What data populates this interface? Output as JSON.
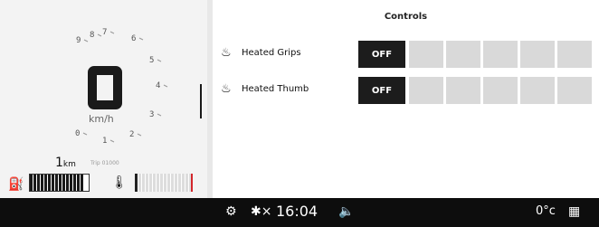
{
  "dashboard": {
    "gauge_ticks": [
      "9",
      "8",
      "7",
      "6",
      "5",
      "4",
      "3",
      "2",
      "1",
      "0"
    ],
    "speed_unit": "km/h",
    "odometer_value": "1",
    "odometer_unit": "km",
    "odometer_small": "Trip 01000",
    "fuel_level": 0.9,
    "temp_level": 0.05
  },
  "controls": {
    "title": "Controls",
    "rows": [
      {
        "label": "Heated Grips",
        "state_label": "OFF",
        "icon": "heated-grips-icon",
        "level": 0
      },
      {
        "label": "Heated Thumb",
        "state_label": "OFF",
        "icon": "heated-thumb-icon",
        "level": 0
      }
    ]
  },
  "statusbar": {
    "clock": "16:04",
    "temperature": "0°c",
    "icons": [
      "settings-icon",
      "bluetooth-off-icon",
      "volume-icon",
      "grid-menu-icon"
    ]
  },
  "colors": {
    "accent_dark": "#1c1c1c",
    "redline": "#d3262b"
  }
}
